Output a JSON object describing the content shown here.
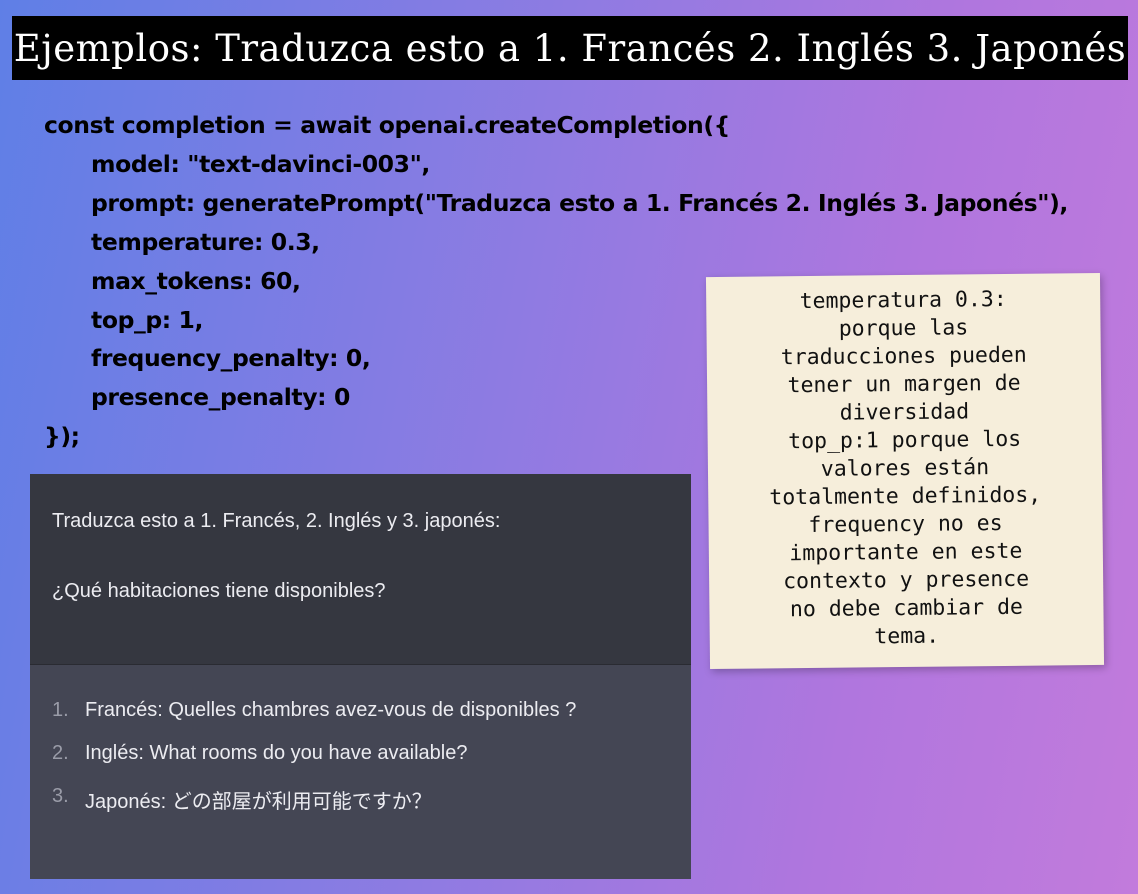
{
  "header": {
    "title": "Ejemplos: Traduzca esto a 1. Francés 2. Inglés 3. Japonés"
  },
  "code": {
    "lines": [
      "const completion = await openai.createCompletion({",
      "model: \"text-davinci-003\",",
      "prompt: generatePrompt(\"Traduzca esto a 1. Francés 2. Inglés 3. Japonés\"),",
      "temperature: 0.3,",
      "max_tokens: 60,",
      "top_p: 1,",
      "frequency_penalty: 0,",
      "presence_penalty: 0",
      "});"
    ]
  },
  "note": {
    "text": "temperatura 0.3:\nporque las\ntraducciones pueden\ntener un margen de\ndiversidad\ntop_p:1 porque los\nvalores están\ntotalmente definidos,\nfrequency no es\nimportante en este\ncontexto y presence\nno debe cambiar de\ntema."
  },
  "chat": {
    "prompt_line1": "Traduzca esto a 1. Francés, 2. Inglés y 3. japonés:",
    "prompt_line2": "¿Qué habitaciones tiene disponibles?",
    "answers": [
      {
        "num": "1.",
        "text": "Francés: Quelles chambres avez-vous de disponibles ?"
      },
      {
        "num": "2.",
        "text": "Inglés: What rooms do you have available?"
      },
      {
        "num": "3.",
        "text": "Japonés: どの部屋が利用可能ですか？"
      }
    ]
  },
  "colors": {
    "title_background": "#000000",
    "note_background": "#f6eedb",
    "chat_prompt_background": "#353740",
    "chat_answer_background": "#444654"
  }
}
